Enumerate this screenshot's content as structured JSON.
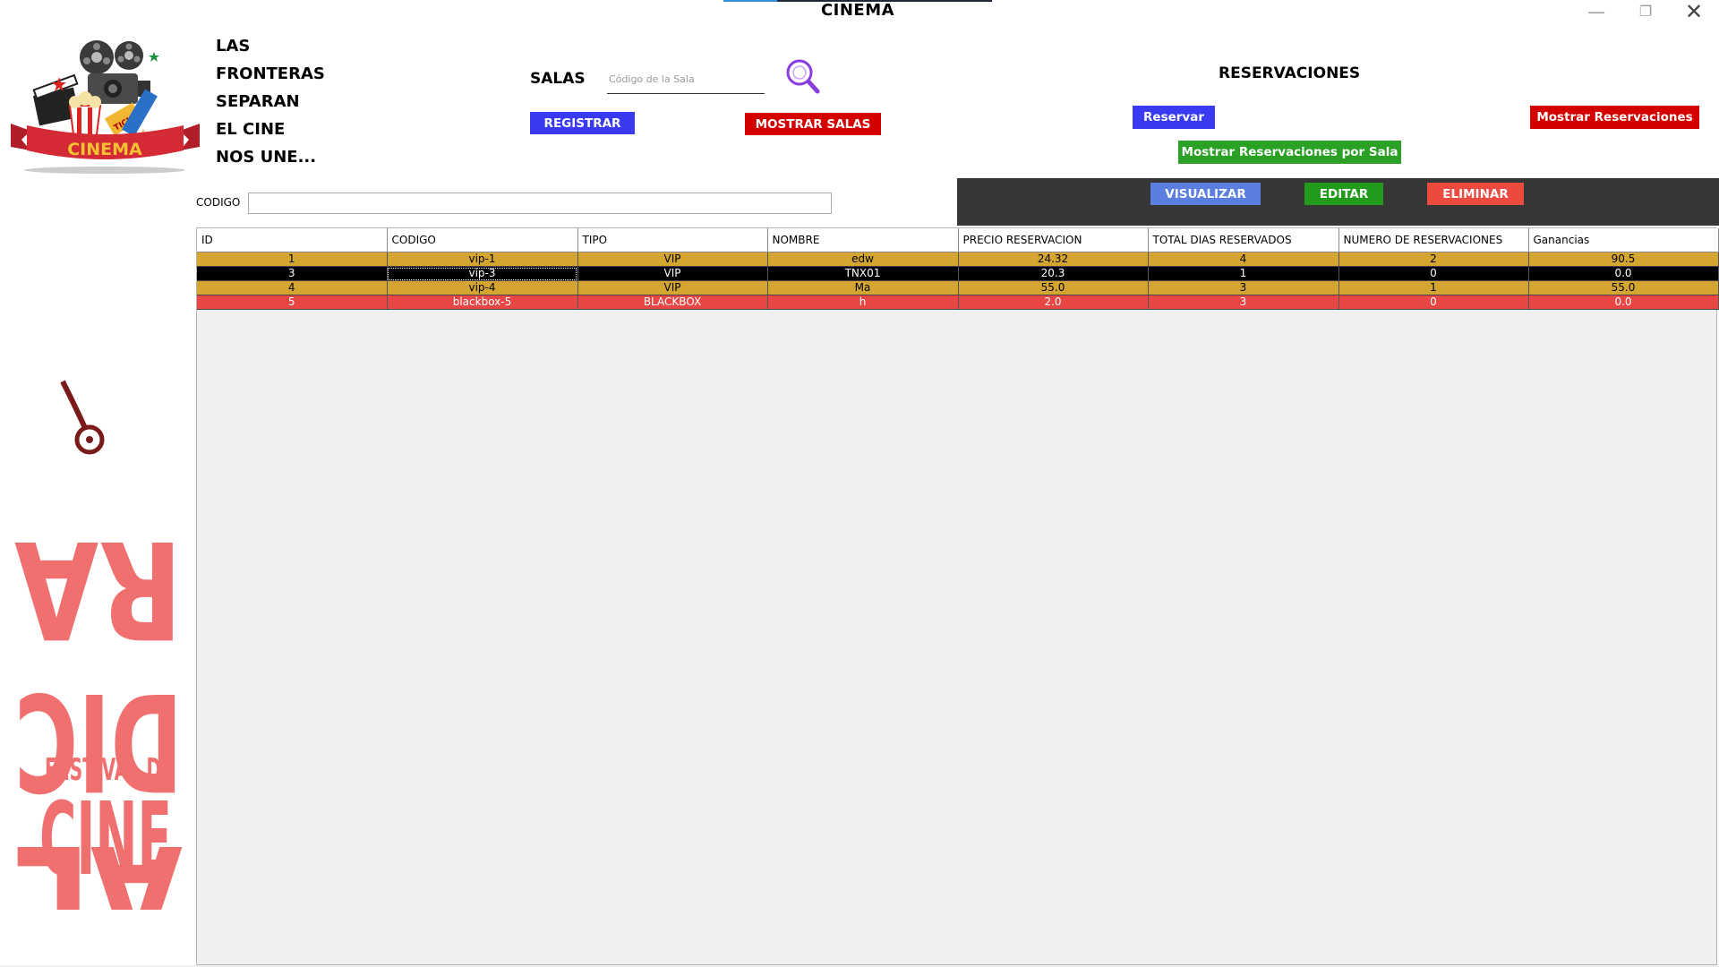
{
  "window": {
    "title": "CINEMA",
    "minimize_glyph": "—",
    "maximize_glyph": "❐",
    "close_glyph": "✕"
  },
  "logo": {
    "text": "CINEMA",
    "ticket_text": "TICKET"
  },
  "slogan": [
    "LAS",
    "FRONTERAS",
    "SEPARAN",
    "EL CINE",
    "NOS UNE..."
  ],
  "salas": {
    "label": "SALAS",
    "search_placeholder": "Código de la Sala",
    "search_value": "",
    "register_label": "REGISTRAR",
    "show_label": "MOSTRAR SALAS"
  },
  "reservaciones": {
    "label": "RESERVACIONES",
    "reserve_label": "Reservar",
    "show_label": "Mostrar Reservaciones",
    "show_by_room_label": "Mostrar Reservaciones por Sala"
  },
  "actions": {
    "view_label": "VISUALIZAR",
    "edit_label": "EDITAR",
    "delete_label": "ELIMINAR"
  },
  "filter": {
    "label": "CODIGO",
    "value": ""
  },
  "poster": {
    "title_lines": [
      "AL",
      "DIC",
      "RA"
    ],
    "subtitle_lines": [
      "FESTIVAL DE",
      "CINE"
    ]
  },
  "table": {
    "columns": [
      "ID",
      "CODIGO",
      "TIPO",
      "NOMBRE",
      "PRECIO RESERVACION",
      "TOTAL DIAS RESERVADOS",
      "NUMERO DE RESERVACIONES",
      "Ganancias"
    ],
    "rows": [
      {
        "style": "gold",
        "cells": [
          "1",
          "vip-1",
          "VIP",
          "edw",
          "24.32",
          "4",
          "2",
          "90.5"
        ]
      },
      {
        "style": "black",
        "cells": [
          "3",
          "vip-3",
          "VIP",
          "TNX01",
          "20.3",
          "1",
          "0",
          "0.0"
        ]
      },
      {
        "style": "gold",
        "cells": [
          "4",
          "vip-4",
          "VIP",
          "Ma",
          "55.0",
          "3",
          "1",
          "55.0"
        ]
      },
      {
        "style": "red",
        "cells": [
          "5",
          "blackbox-5",
          "BLACKBOX",
          "h",
          "2.0",
          "3",
          "0",
          "0.0"
        ]
      }
    ]
  },
  "colors": {
    "row_gold": "#d4a531",
    "row_selected": "#000000",
    "row_red": "#e84545",
    "dark_panel": "#363636",
    "register_button": "#3a3af2",
    "show_rooms_button": "#d40000",
    "reserve_button": "#3a3af2",
    "show_reservations_button": "#d40000",
    "show_by_room_button": "#2aa024",
    "view_button": "#5b7fe0",
    "edit_button": "#229a1c",
    "delete_button": "#ec4a3f",
    "poster_text": "#f07070"
  },
  "icons": {
    "search": "magnifier-icon",
    "logo": "cinema-logo",
    "poster": "festival-poster"
  }
}
